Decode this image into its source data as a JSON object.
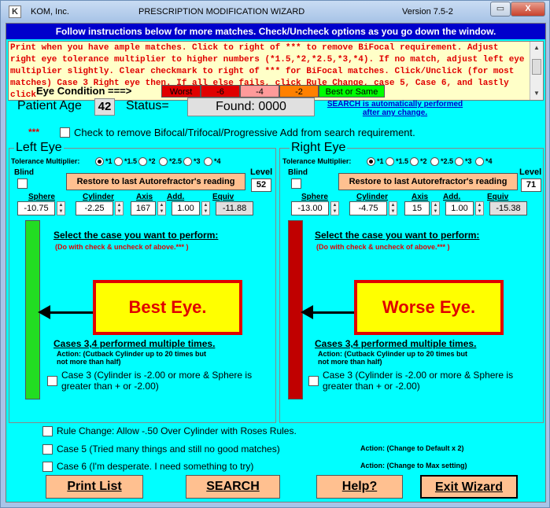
{
  "title": {
    "company": "KOM, Inc.",
    "name": "PRESCRIPTION MODIFICATION WIZARD",
    "version": "Version 7.5-2",
    "minimize": "▭",
    "close": "X"
  },
  "instructions_bar": "Follow instructions below for more matches. Check/Uncheck options as you go down the window.",
  "message_text": "Print when you have ample matches. Click to right of *** to remove BiFocal requirement. Adjust right eye tolerance multiplier to higher numbers (*1.5,*2,*2.5,*3,*4). If no match, adjust left eye multiplier slightly. Clear checkmark to right of *** for BiFocal matches. Click/Unclick (for most matches) Case 3 Right eye then. If all else fails, click Rule Change, case 5, Case 6, and  lastly click",
  "eye_condition": {
    "label": "Eye Condition ===>",
    "scale": [
      {
        "text": "Worst",
        "color": "#e00000"
      },
      {
        "text": "-6",
        "color": "#e00000"
      },
      {
        "text": "-4",
        "color": "#ff9a9a"
      },
      {
        "text": "-2",
        "color": "#ff8000"
      },
      {
        "text": "Best or Same",
        "color": "#00ff00"
      }
    ]
  },
  "patient": {
    "age_label": "Patient Age",
    "age": "42",
    "status_label": "Status=",
    "status": "Found:  0000",
    "search_note": "SEARCH is automatically performed after any change."
  },
  "bifocal": {
    "stars": "***",
    "label": "Check to remove Bifocal/Trifocal/Progressive Add from search requirement."
  },
  "common": {
    "tolerance_label": "Tolerance Multiplier:",
    "tolerance_options": [
      "*1",
      "*1.5",
      "*2",
      "*2.5",
      "*3",
      "*4"
    ],
    "blind": "Blind",
    "restore": "Restore to last Autorefractor's reading",
    "level": "Level",
    "headers": [
      "Sphere",
      "Cylinder",
      "Axis",
      "Add.",
      "Equiv"
    ],
    "select_case": "Select the case you want to perform:",
    "do_with": "(Do with check & uncheck of above.***  )",
    "cases_multi": "Cases 3,4 performed multiple times.",
    "action": "Action:  (Cutback Cylinder up to 20 times but not more than half)",
    "case3": "Case 3 (Cylinder is -2.00 or more & Sphere is greater than + or -2.00)"
  },
  "left_eye": {
    "title": "Left Eye",
    "level": "52",
    "sphere": "-10.75",
    "cylinder": "-2.25",
    "axis": "167",
    "add": "1.00",
    "equiv": "-11.88",
    "bar_color": "#22dd22",
    "label": "Best Eye."
  },
  "right_eye": {
    "title": "Right Eye",
    "level": "71",
    "sphere": "-13.00",
    "cylinder": "-4.75",
    "axis": "15",
    "add": "1.00",
    "equiv": "-15.38",
    "bar_color": "#c00000",
    "label": "Worse Eye."
  },
  "options": {
    "rule_change": "Rule Change: Allow -.50 Over Cylinder with Roses Rules.",
    "case5": "Case 5 (Tried many things and still no good matches)",
    "case5_action": "Action:  (Change to Default x 2)",
    "case6": "Case 6 (I'm desperate.  I need something to try)",
    "case6_action": "Action:  (Change to Max setting)"
  },
  "buttons": {
    "print": "Print List",
    "search": "SEARCH",
    "help": "Help?",
    "exit": "Exit Wizard"
  }
}
